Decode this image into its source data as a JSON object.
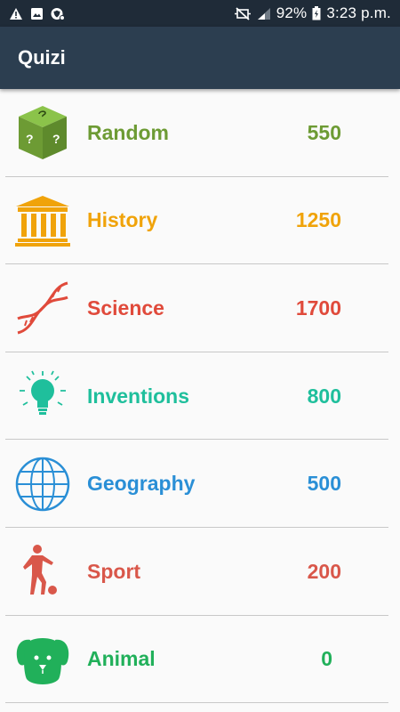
{
  "status": {
    "battery": "92%",
    "time": "3:23 p.m.",
    "icons": [
      "warning-icon",
      "image-icon",
      "shield-icon",
      "mute-icon",
      "signal-icon",
      "battery-icon"
    ]
  },
  "app": {
    "title": "Quizi"
  },
  "categories": [
    {
      "label": "Random",
      "score": "550",
      "color": "#6d9b34",
      "icon": "dice-icon"
    },
    {
      "label": "History",
      "score": "1250",
      "color": "#f0a30a",
      "icon": "museum-icon"
    },
    {
      "label": "Science",
      "score": "1700",
      "color": "#e04a3b",
      "icon": "dna-icon"
    },
    {
      "label": "Inventions",
      "score": "800",
      "color": "#1fbf9c",
      "icon": "lightbulb-icon"
    },
    {
      "label": "Geography",
      "score": "500",
      "color": "#2a8fd6",
      "icon": "globe-icon"
    },
    {
      "label": "Sport",
      "score": "200",
      "color": "#d9574a",
      "icon": "soccer-player-icon"
    },
    {
      "label": "Animal",
      "score": "0",
      "color": "#21b05a",
      "icon": "dog-icon"
    }
  ]
}
